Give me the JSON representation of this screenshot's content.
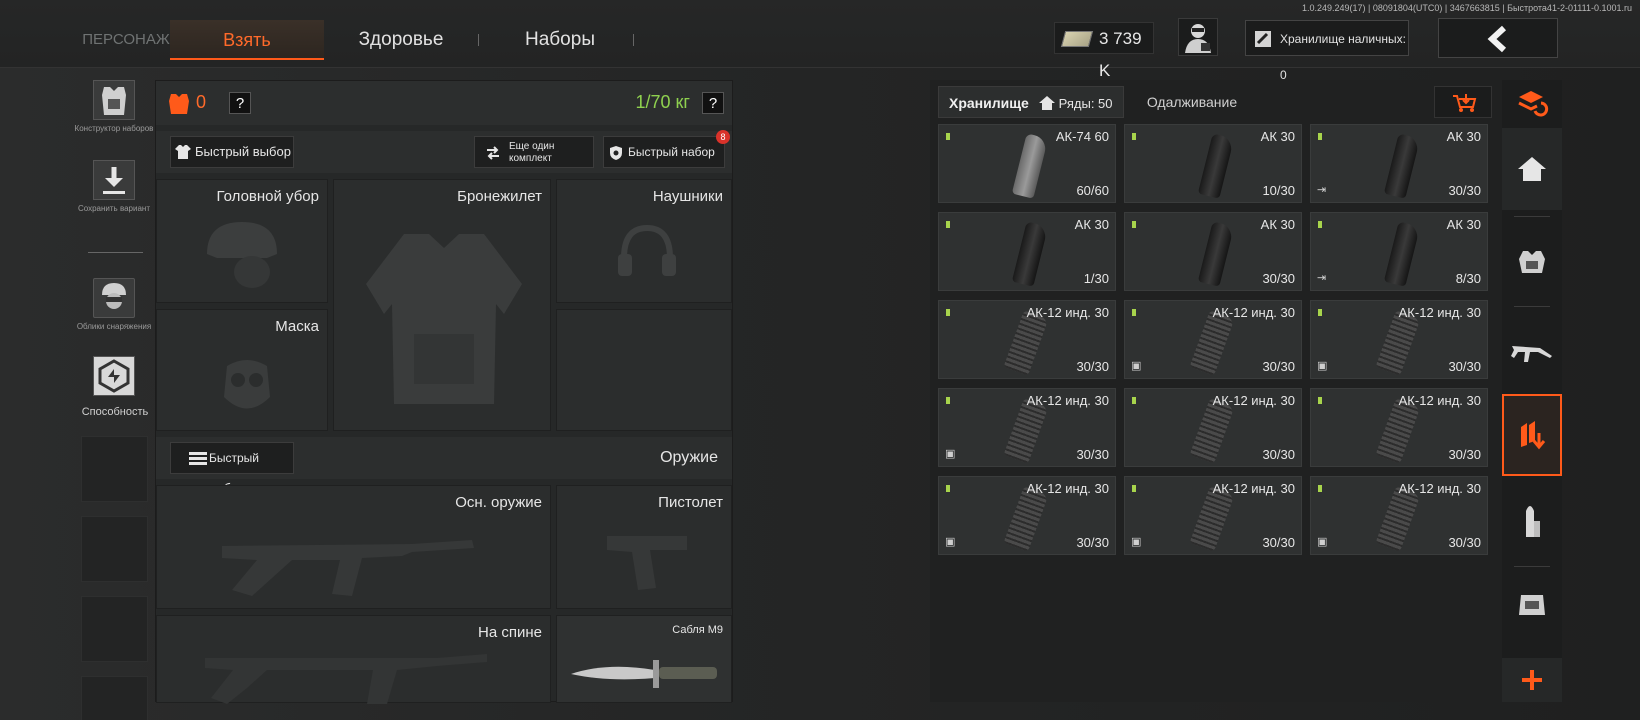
{
  "version": "1.0.249.249(17) | 08091804(UTC0) | 3467663815 | Быстрота41-2-01111-0.1001.ru",
  "tabs": {
    "person": "ПЕРСОНАЖ",
    "take": "Взять",
    "health": "Здоровье",
    "kits": "Наборы"
  },
  "header": {
    "money": "3 739 K",
    "cash_storage": "Хранилище наличных: 0"
  },
  "left": {
    "kit_builder": "Конструктор наборов",
    "save_variant": "Сохранить вариант",
    "gear_skins": "Облики снаряжения",
    "ability": "Способность"
  },
  "equipment": {
    "armor_count": "0",
    "weight": "1/70 кг",
    "help": "?",
    "quick_select": "Быстрый выбор",
    "another_set": "Еще один комплект",
    "quick_kit": "Быстрый набор",
    "quick_kit_badge": "8",
    "slots": {
      "headwear": "Головной убор",
      "vest": "Бронежилет",
      "headphones": "Наушники",
      "mask": "Маска"
    },
    "weapon_quick_select": "Быстрый выбор",
    "weapons_title": "Оружие",
    "weapons": {
      "primary": "Осн. оружие",
      "pistol": "Пистолет",
      "back": "На спине",
      "melee": "Сабля М9"
    }
  },
  "storage": {
    "tab_storage": "Хранилище",
    "rows": "Ряды: 50",
    "tab_borrow": "Одалживание",
    "items": [
      {
        "name": "АК-74 60",
        "qty": "60/60",
        "kind": "light",
        "badge": ""
      },
      {
        "name": "АК 30",
        "qty": "10/30",
        "kind": "dark",
        "badge": ""
      },
      {
        "name": "АК 30",
        "qty": "30/30",
        "kind": "dark",
        "badge": "⇥"
      },
      {
        "name": "АК 30",
        "qty": "1/30",
        "kind": "dark",
        "badge": ""
      },
      {
        "name": "АК 30",
        "qty": "30/30",
        "kind": "dark",
        "badge": ""
      },
      {
        "name": "АК 30",
        "qty": "8/30",
        "kind": "dark",
        "badge": "⇥"
      },
      {
        "name": "АК-12 инд. 30",
        "qty": "30/30",
        "kind": "long",
        "badge": ""
      },
      {
        "name": "АК-12 инд. 30",
        "qty": "30/30",
        "kind": "long",
        "badge": "▣"
      },
      {
        "name": "АК-12 инд. 30",
        "qty": "30/30",
        "kind": "long",
        "badge": "▣"
      },
      {
        "name": "АК-12 инд. 30",
        "qty": "30/30",
        "kind": "long",
        "badge": "▣"
      },
      {
        "name": "АК-12 инд. 30",
        "qty": "30/30",
        "kind": "long",
        "badge": ""
      },
      {
        "name": "АК-12 инд. 30",
        "qty": "30/30",
        "kind": "long",
        "badge": ""
      },
      {
        "name": "АК-12 инд. 30",
        "qty": "30/30",
        "kind": "long",
        "badge": "▣"
      },
      {
        "name": "АК-12 инд. 30",
        "qty": "30/30",
        "kind": "long",
        "badge": "▣"
      },
      {
        "name": "АК-12 инд. 30",
        "qty": "30/30",
        "kind": "long",
        "badge": "▣"
      }
    ]
  },
  "colors": {
    "accent": "#ff5a1a",
    "weight_green": "#8fd14f",
    "item_dot": "#a8d44c"
  },
  "rail_icons": [
    "layers-refresh-icon",
    "home-icon",
    "vest-icon",
    "rifle-icon",
    "ammo-down-icon",
    "cartridge-icon",
    "backpack-icon",
    "plus-icon"
  ]
}
